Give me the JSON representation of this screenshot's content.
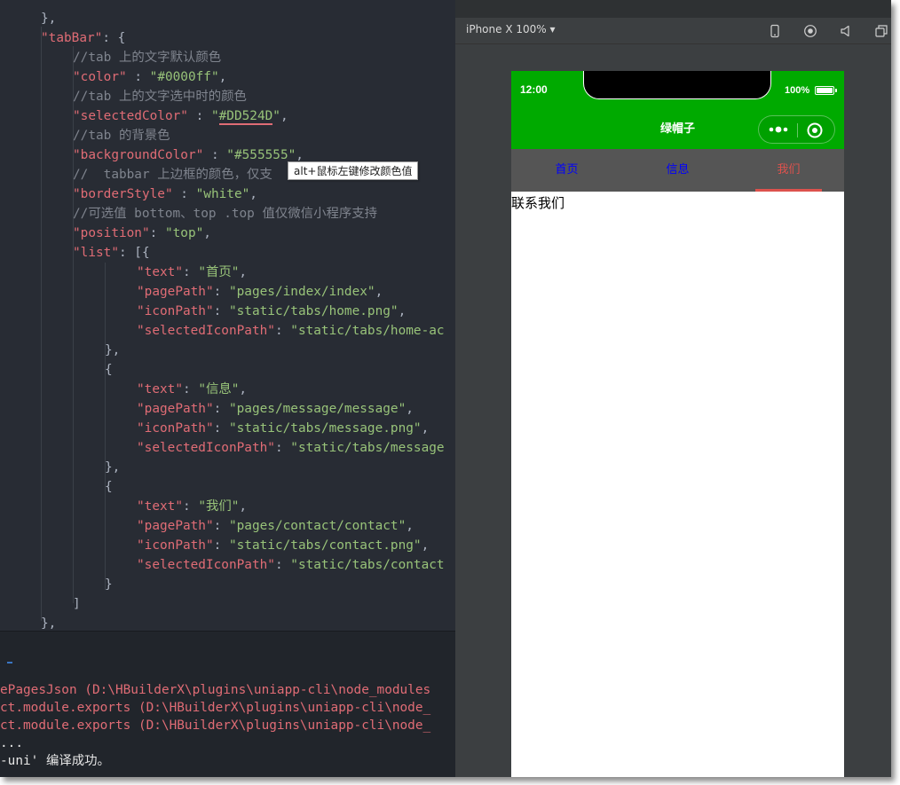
{
  "editor": {
    "lines": [
      [
        [
          "p",
          "},"
        ]
      ],
      [
        [
          "k",
          "\"tabBar\""
        ],
        [
          "p",
          ": {"
        ]
      ],
      [
        [
          "c",
          "//tab 上的文字默认颜色"
        ]
      ],
      [
        [
          "k",
          "\"color\""
        ],
        [
          "p",
          " : "
        ],
        [
          "s",
          "\"#0000ff\""
        ],
        [
          "p",
          ","
        ]
      ],
      [
        [
          "c",
          "//tab 上的文字选中时的颜色"
        ]
      ],
      [
        [
          "k",
          "\"selectedColor\""
        ],
        [
          "p",
          " : "
        ],
        [
          "s",
          "\""
        ],
        [
          "su",
          "#DD524D"
        ],
        [
          "s",
          "\""
        ],
        [
          "p",
          ","
        ]
      ],
      [
        [
          "c",
          "//tab 的背景色"
        ]
      ],
      [
        [
          "k",
          "\"backgroundColor\""
        ],
        [
          "p",
          " : "
        ],
        [
          "s",
          "\"#555555\""
        ],
        [
          "p",
          ","
        ]
      ],
      [
        [
          "c",
          "//  tabbar 上边框的颜色，仅支"
        ]
      ],
      [
        [
          "k",
          "\"borderStyle\""
        ],
        [
          "p",
          " : "
        ],
        [
          "s",
          "\"white\""
        ],
        [
          "p",
          ","
        ]
      ],
      [
        [
          "c",
          "//可选值 bottom、top .top 值仅微信小程序支持"
        ]
      ],
      [
        [
          "k",
          "\"position\""
        ],
        [
          "p",
          ": "
        ],
        [
          "s",
          "\"top\""
        ],
        [
          "p",
          ","
        ]
      ],
      [
        [
          "k",
          "\"list\""
        ],
        [
          "p",
          ": [{"
        ]
      ],
      [
        [
          "k",
          "\"text\""
        ],
        [
          "p",
          ": "
        ],
        [
          "s",
          "\"首页\""
        ],
        [
          "p",
          ","
        ]
      ],
      [
        [
          "k",
          "\"pagePath\""
        ],
        [
          "p",
          ": "
        ],
        [
          "s",
          "\"pages/index/index\""
        ],
        [
          "p",
          ","
        ]
      ],
      [
        [
          "k",
          "\"iconPath\""
        ],
        [
          "p",
          ": "
        ],
        [
          "s",
          "\"static/tabs/home.png\""
        ],
        [
          "p",
          ","
        ]
      ],
      [
        [
          "k",
          "\"selectedIconPath\""
        ],
        [
          "p",
          ": "
        ],
        [
          "s",
          "\"static/tabs/home-ac"
        ]
      ],
      [
        [
          "p",
          "},"
        ]
      ],
      [
        [
          "p",
          "{"
        ]
      ],
      [
        [
          "k",
          "\"text\""
        ],
        [
          "p",
          ": "
        ],
        [
          "s",
          "\"信息\""
        ],
        [
          "p",
          ","
        ]
      ],
      [
        [
          "k",
          "\"pagePath\""
        ],
        [
          "p",
          ": "
        ],
        [
          "s",
          "\"pages/message/message\""
        ],
        [
          "p",
          ","
        ]
      ],
      [
        [
          "k",
          "\"iconPath\""
        ],
        [
          "p",
          ": "
        ],
        [
          "s",
          "\"static/tabs/message.png\""
        ],
        [
          "p",
          ","
        ]
      ],
      [
        [
          "k",
          "\"selectedIconPath\""
        ],
        [
          "p",
          ": "
        ],
        [
          "s",
          "\"static/tabs/message"
        ]
      ],
      [
        [
          "p",
          "},"
        ]
      ],
      [
        [
          "p",
          "{"
        ]
      ],
      [
        [
          "k",
          "\"text\""
        ],
        [
          "p",
          ": "
        ],
        [
          "s",
          "\"我们\""
        ],
        [
          "p",
          ","
        ]
      ],
      [
        [
          "k",
          "\"pagePath\""
        ],
        [
          "p",
          ": "
        ],
        [
          "s",
          "\"pages/contact/contact\""
        ],
        [
          "p",
          ","
        ]
      ],
      [
        [
          "k",
          "\"iconPath\""
        ],
        [
          "p",
          ": "
        ],
        [
          "s",
          "\"static/tabs/contact.png\""
        ],
        [
          "p",
          ","
        ]
      ],
      [
        [
          "k",
          "\"selectedIconPath\""
        ],
        [
          "p",
          ": "
        ],
        [
          "s",
          "\"static/tabs/contact"
        ]
      ],
      [
        [
          "p",
          "}"
        ]
      ],
      [
        [
          "p",
          "]"
        ]
      ],
      [
        [
          "p",
          "},"
        ]
      ]
    ],
    "tooltip": "alt+鼠标左键修改颜色值"
  },
  "console": {
    "lines": [
      "ePagesJson (D:\\HBuilderX\\plugins\\uniapp-cli\\node_modules",
      "ct.module.exports (D:\\HBuilderX\\plugins\\uniapp-cli\\node_",
      "ct.module.exports (D:\\HBuilderX\\plugins\\uniapp-cli\\node_",
      "...",
      "-uni' 编译成功。"
    ]
  },
  "simulator": {
    "device_label": "iPhone X 100%",
    "toolbar_icons": [
      "phone-icon",
      "record-icon",
      "volume-icon",
      "window-icon"
    ],
    "status_time": "12:00",
    "battery_text": "100%",
    "nav_title": "绿帽子",
    "tabbar": {
      "background": "#555555",
      "color": "#0000ff",
      "selected_color": "#DD524D",
      "items": [
        {
          "label": "首页",
          "selected": false
        },
        {
          "label": "信息",
          "selected": false
        },
        {
          "label": "我们",
          "selected": true
        }
      ]
    },
    "page_text": "联系我们"
  }
}
